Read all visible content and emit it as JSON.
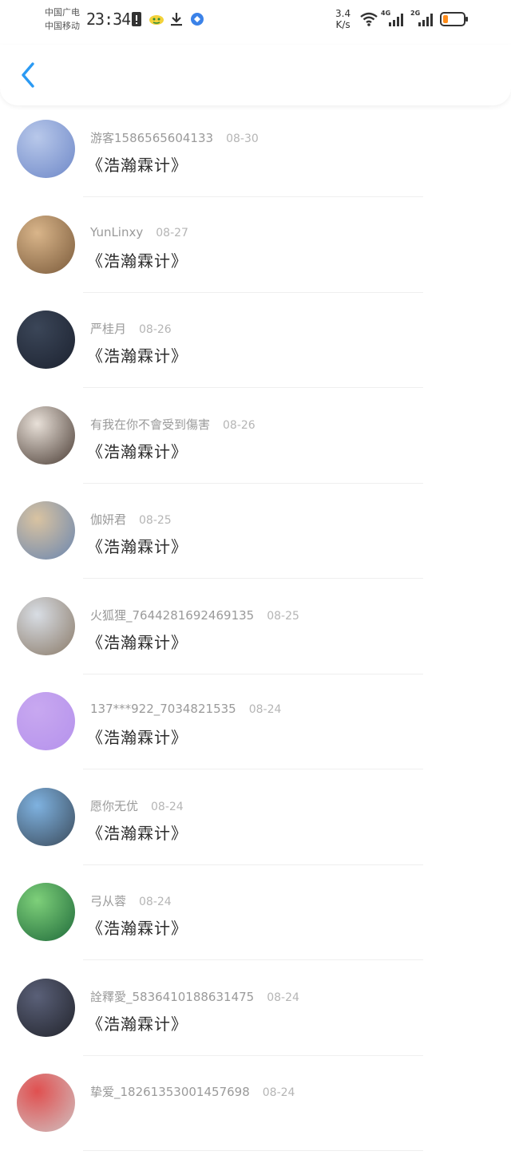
{
  "status_bar": {
    "carrier_1": "中国广电",
    "carrier_2": "中国移动",
    "time": "23:34",
    "net_speed_value": "3.4",
    "net_speed_unit": "K/s",
    "net_1": "4G",
    "net_2": "2G",
    "battery_color": "#ff8c1a"
  },
  "header": {
    "back_icon": "chevron-left-icon",
    "accent_color": "#2b9af3"
  },
  "items": [
    {
      "user": "游客1586565604133",
      "date": "08-30",
      "message": "《浩瀚霖计》",
      "avatar_colors": [
        "#b8c8ea",
        "#6e88c8"
      ]
    },
    {
      "user": "YunLinxy",
      "date": "08-27",
      "message": "《浩瀚霖计》",
      "avatar_colors": [
        "#d9b58a",
        "#7a5a3a"
      ]
    },
    {
      "user": "严桂月",
      "date": "08-26",
      "message": "《浩瀚霖计》",
      "avatar_colors": [
        "#3b4658",
        "#1c2230"
      ]
    },
    {
      "user": "有我在你不會受到傷害",
      "date": "08-26",
      "message": "《浩瀚霖计》",
      "avatar_colors": [
        "#e8e0d8",
        "#4a3c34"
      ]
    },
    {
      "user": "伽妍君",
      "date": "08-25",
      "message": "《浩瀚霖计》",
      "avatar_colors": [
        "#d9c3a1",
        "#6a86b0"
      ]
    },
    {
      "user": "火狐狸_7644281692469135",
      "date": "08-25",
      "message": "《浩瀚霖计》",
      "avatar_colors": [
        "#d8dde4",
        "#8a7a68"
      ]
    },
    {
      "user": "137***922_7034821535",
      "date": "08-24",
      "message": "《浩瀚霖计》",
      "avatar_colors": [
        "#c8a8f0",
        "#b592ec"
      ]
    },
    {
      "user": "愿你无优",
      "date": "08-24",
      "message": "《浩瀚霖计》",
      "avatar_colors": [
        "#7fb2e0",
        "#3a4a5a"
      ]
    },
    {
      "user": "弓从蓉",
      "date": "08-24",
      "message": "《浩瀚霖计》",
      "avatar_colors": [
        "#7ed07a",
        "#1f6a3a"
      ]
    },
    {
      "user": "詮釋愛_5836410188631475",
      "date": "08-24",
      "message": "《浩瀚霖计》",
      "avatar_colors": [
        "#5a6078",
        "#22242c"
      ]
    },
    {
      "user": "挚爱_18261353001457698",
      "date": "08-24",
      "message": "",
      "avatar_colors": [
        "#e05050",
        "#d0c0c0"
      ]
    }
  ]
}
